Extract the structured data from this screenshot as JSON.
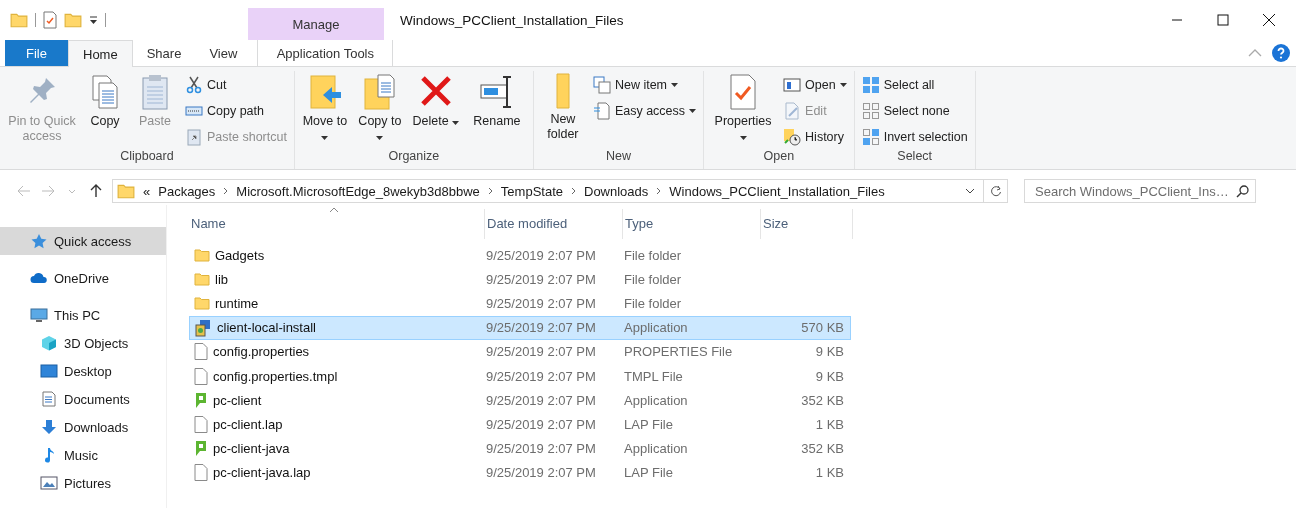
{
  "window": {
    "title": "Windows_PCClient_Installation_Files"
  },
  "context_tab": {
    "header": "Manage"
  },
  "tabs": [
    {
      "label": "File",
      "kind": "file",
      "selected": false
    },
    {
      "label": "Home",
      "kind": "tab",
      "selected": true
    },
    {
      "label": "Share",
      "kind": "tab",
      "selected": false
    },
    {
      "label": "View",
      "kind": "tab",
      "selected": false
    },
    {
      "label": "Application Tools",
      "kind": "context",
      "selected": false
    }
  ],
  "ribbon": [
    {
      "name": "Clipboard",
      "large": [
        {
          "label": "Pin to Quick access",
          "disabled": true,
          "dropdown": false
        },
        {
          "label": "Copy",
          "disabled": false,
          "dropdown": false
        },
        {
          "label": "Paste",
          "disabled": true,
          "dropdown": false
        }
      ],
      "small": [
        {
          "label": "Cut",
          "disabled": false,
          "dropdown": false
        },
        {
          "label": "Copy path",
          "disabled": false,
          "dropdown": false
        },
        {
          "label": "Paste shortcut",
          "disabled": true,
          "dropdown": false
        }
      ]
    },
    {
      "name": "Organize",
      "large": [
        {
          "label": "Move to",
          "disabled": false,
          "dropdown": true
        },
        {
          "label": "Copy to",
          "disabled": false,
          "dropdown": true
        },
        {
          "label": "Delete",
          "disabled": false,
          "dropdown": true
        },
        {
          "label": "Rename",
          "disabled": false,
          "dropdown": false
        }
      ]
    },
    {
      "name": "New",
      "large": [
        {
          "label": "New folder",
          "disabled": false,
          "dropdown": false
        }
      ],
      "small": [
        {
          "label": "New item",
          "disabled": false,
          "dropdown": true
        },
        {
          "label": "Easy access",
          "disabled": false,
          "dropdown": true
        }
      ]
    },
    {
      "name": "Open",
      "large": [
        {
          "label": "Properties",
          "disabled": false,
          "dropdown": true
        }
      ],
      "small": [
        {
          "label": "Open",
          "disabled": false,
          "dropdown": true
        },
        {
          "label": "Edit",
          "disabled": true,
          "dropdown": false
        },
        {
          "label": "History",
          "disabled": false,
          "dropdown": false
        }
      ]
    },
    {
      "name": "Select",
      "small": [
        {
          "label": "Select all",
          "disabled": false,
          "dropdown": false
        },
        {
          "label": "Select none",
          "disabled": false,
          "dropdown": false
        },
        {
          "label": "Invert selection",
          "disabled": false,
          "dropdown": false
        }
      ]
    }
  ],
  "address_bar": {
    "overflow": "«",
    "path": [
      "Packages",
      "Microsoft.MicrosoftEdge_8wekyb3d8bbwe",
      "TempState",
      "Downloads",
      "Windows_PCClient_Installation_Files"
    ]
  },
  "search": {
    "placeholder": "Search Windows_PCClient_Ins…"
  },
  "sidebar": {
    "items": [
      {
        "label": "Quick access",
        "kind": "star",
        "selected": true
      },
      {
        "label": "OneDrive",
        "kind": "cloud",
        "selected": false
      },
      {
        "label": "This PC",
        "kind": "pc",
        "selected": false,
        "children": [
          {
            "label": "3D Objects",
            "kind": "cube",
            "selected": false
          },
          {
            "label": "Desktop",
            "kind": "desktop",
            "selected": false
          },
          {
            "label": "Documents",
            "kind": "documents",
            "selected": false
          },
          {
            "label": "Downloads",
            "kind": "downloads",
            "selected": false
          },
          {
            "label": "Music",
            "kind": "music",
            "selected": false
          },
          {
            "label": "Pictures",
            "kind": "pictures",
            "selected": false
          }
        ]
      }
    ]
  },
  "table": {
    "columns": [
      "Name",
      "Date modified",
      "Type",
      "Size"
    ],
    "rows": [
      {
        "name": "Gadgets",
        "kind": "folder",
        "date": "9/25/2019 2:07 PM",
        "type": "File folder",
        "size": "",
        "selected": false
      },
      {
        "name": "lib",
        "kind": "folder",
        "date": "9/25/2019 2:07 PM",
        "type": "File folder",
        "size": "",
        "selected": false
      },
      {
        "name": "runtime",
        "kind": "folder",
        "date": "9/25/2019 2:07 PM",
        "type": "File folder",
        "size": "",
        "selected": false
      },
      {
        "name": "client-local-install",
        "kind": "installer",
        "date": "9/25/2019 2:07 PM",
        "type": "Application",
        "size": "570 KB",
        "selected": true
      },
      {
        "name": "config.properties",
        "kind": "document",
        "date": "9/25/2019 2:07 PM",
        "type": "PROPERTIES File",
        "size": "9 KB",
        "selected": false
      },
      {
        "name": "config.properties.tmpl",
        "kind": "document",
        "date": "9/25/2019 2:07 PM",
        "type": "TMPL File",
        "size": "9 KB",
        "selected": false
      },
      {
        "name": "pc-client",
        "kind": "app",
        "date": "9/25/2019 2:07 PM",
        "type": "Application",
        "size": "352 KB",
        "selected": false
      },
      {
        "name": "pc-client.lap",
        "kind": "document",
        "date": "9/25/2019 2:07 PM",
        "type": "LAP File",
        "size": "1 KB",
        "selected": false
      },
      {
        "name": "pc-client-java",
        "kind": "app",
        "date": "9/25/2019 2:07 PM",
        "type": "Application",
        "size": "352 KB",
        "selected": false
      },
      {
        "name": "pc-client-java.lap",
        "kind": "document",
        "date": "9/25/2019 2:07 PM",
        "type": "LAP File",
        "size": "1 KB",
        "selected": false
      }
    ]
  }
}
